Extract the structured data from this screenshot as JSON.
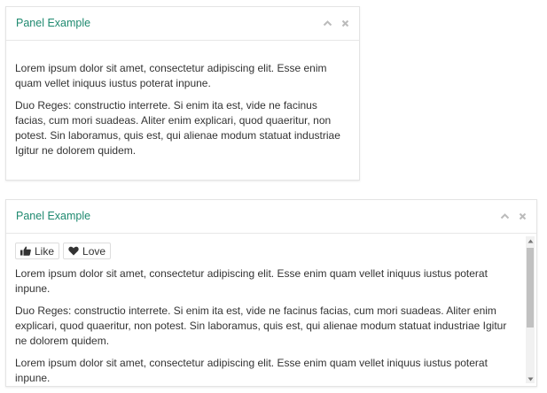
{
  "panel1": {
    "title": "Panel Example",
    "collapse_icon": "chevron-up-icon",
    "close_icon": "close-icon",
    "paragraphs": [
      "Lorem ipsum dolor sit amet, consectetur adipiscing elit. Esse enim quam vellet iniquus iustus poterat inpune.",
      "Duo Reges: constructio interrete. Si enim ita est, vide ne facinus facias, cum mori suadeas. Aliter enim explicari, quod quaeritur, non potest. Sin laboramus, quis est, qui alienae modum statuat industriae Igitur ne dolorem quidem."
    ]
  },
  "panel2": {
    "title": "Panel Example",
    "collapse_icon": "chevron-up-icon",
    "close_icon": "close-icon",
    "buttons": {
      "like_label": "Like",
      "love_label": "Love"
    },
    "paragraphs": [
      "Lorem ipsum dolor sit amet, consectetur adipiscing elit. Esse enim quam vellet iniquus iustus poterat inpune.",
      "Duo Reges: constructio interrete. Si enim ita est, vide ne facinus facias, cum mori suadeas. Aliter enim explicari, quod quaeritur, non potest. Sin laboramus, quis est, qui alienae modum statuat industriae Igitur ne dolorem quidem.",
      "Lorem ipsum dolor sit amet, consectetur adipiscing elit. Esse enim quam vellet iniquus iustus poterat inpune."
    ]
  },
  "colors": {
    "title": "#1f8a70",
    "text": "#333333",
    "border": "#e4e4e4",
    "icon": "#bbbbbb"
  }
}
